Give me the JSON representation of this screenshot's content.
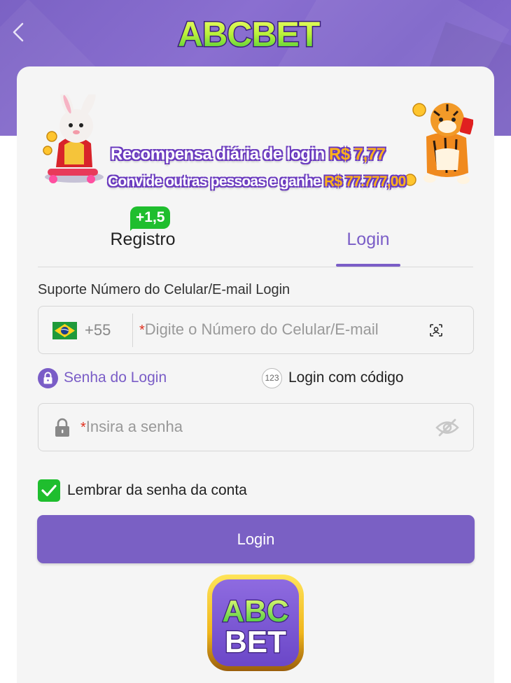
{
  "header": {
    "back_icon": "chevron-left-icon",
    "brand": "ABCBET"
  },
  "banner": {
    "line1_text": "Recompensa diária de login",
    "line1_amount": "R$ 7,77",
    "line2_text": "Convide outras pessoas e ganhe",
    "line2_amount": "R$ 77.777,00"
  },
  "tabs": {
    "register_label": "Registro",
    "register_badge": "+1,5",
    "login_label": "Login",
    "active": "Login"
  },
  "form": {
    "support_label": "Suporte Número do Celular/E-mail Login",
    "country_code": "+55",
    "required_mark": "*",
    "phone_placeholder": "Digite o Número do Celular/E-mail",
    "method_password_label": "Senha do Login",
    "method_code_icon_text": "123",
    "method_code_label": "Login com código",
    "password_placeholder": "Insira a senha",
    "remember_label": "Lembrar da senha da conta",
    "remember_checked": true,
    "submit_label": "Login"
  },
  "footer_logo": {
    "line1": "ABC",
    "line2": "BET"
  },
  "colors": {
    "accent": "#7a5dc7",
    "header_bg": "#7f66c8",
    "success": "#1fbe2e",
    "gold": "#ffb21a"
  }
}
